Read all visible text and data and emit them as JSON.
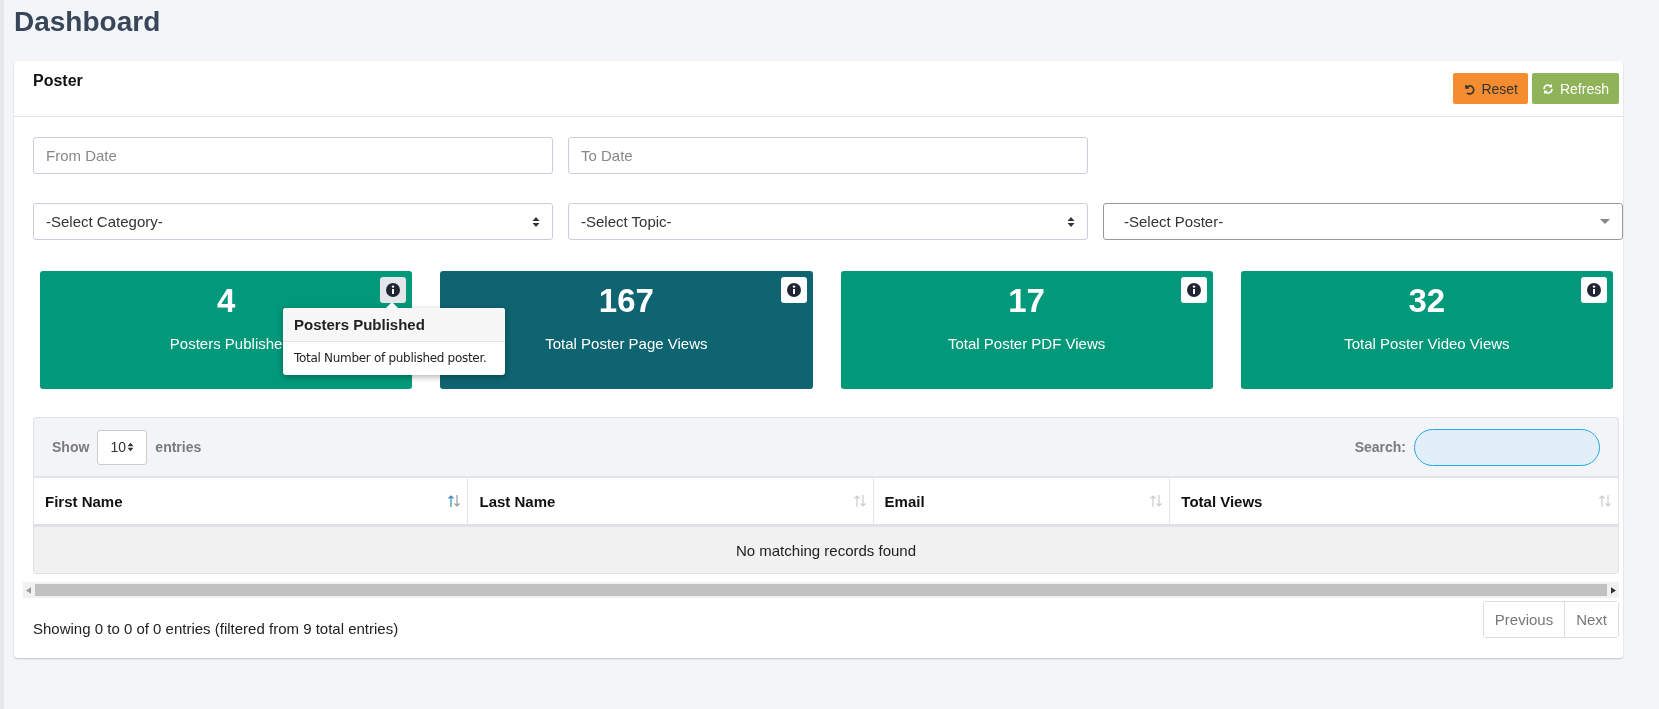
{
  "page_title": "Dashboard",
  "panel": {
    "title": "Poster",
    "buttons": [
      {
        "kind": "reset",
        "label": "Reset"
      },
      {
        "kind": "refresh",
        "label": "Refresh"
      }
    ]
  },
  "filters": [
    {
      "kind": "date",
      "placeholder": "From Date"
    },
    {
      "kind": "date",
      "placeholder": "To Date"
    },
    {
      "kind": "spacer"
    },
    {
      "kind": "select",
      "value": "-Select Category-"
    },
    {
      "kind": "select",
      "value": "-Select Topic-"
    },
    {
      "kind": "combo",
      "value": "-Select Poster-"
    }
  ],
  "stats": [
    {
      "value": "4",
      "label": "Posters Publishe",
      "color": "#02987a",
      "tooltip": {
        "title": "Posters Published",
        "text": "Total Number of published poster."
      }
    },
    {
      "value": "167",
      "label": "Total Poster Page Views",
      "color": "#0e6470"
    },
    {
      "value": "17",
      "label": "Total Poster PDF Views",
      "color": "#02987a"
    },
    {
      "value": "32",
      "label": "Total Poster Video Views",
      "color": "#02987a"
    }
  ],
  "table": {
    "show_label": "Show",
    "page_size": "10",
    "entries_label": "entries",
    "search_label": "Search:",
    "search_focused": true,
    "columns": [
      {
        "label": "First Name",
        "sorted": true
      },
      {
        "label": "Last Name",
        "sorted": false
      },
      {
        "label": "Email",
        "sorted": false
      },
      {
        "label": "Total Views",
        "sorted": false
      }
    ],
    "empty_message": "No matching records found",
    "info": "Showing 0 to 0 of 0 entries (filtered from 9 total entries)",
    "pagination": [
      {
        "label": "Previous",
        "disabled": true
      },
      {
        "label": "Next",
        "disabled": true
      }
    ]
  }
}
